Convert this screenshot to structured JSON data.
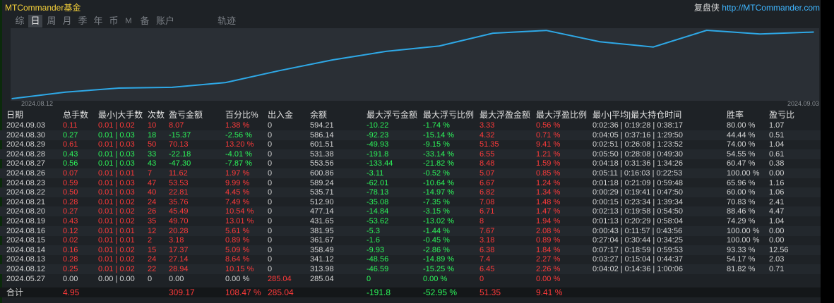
{
  "app_title": "MTCommander基金",
  "header_right": {
    "label": "复盘侠",
    "site": "http://MTCommander.com"
  },
  "tabs": [
    {
      "label": "综",
      "active": false,
      "small": false
    },
    {
      "label": "日",
      "active": true,
      "small": false
    },
    {
      "label": "周",
      "active": false,
      "small": false
    },
    {
      "label": "月",
      "active": false,
      "small": false
    },
    {
      "label": "季",
      "active": false,
      "small": false
    },
    {
      "label": "年",
      "active": false,
      "small": false
    },
    {
      "label": "币",
      "active": false,
      "small": false
    },
    {
      "label": "M",
      "active": false,
      "small": true
    },
    {
      "label": "备",
      "active": false,
      "small": false
    },
    {
      "label": "账户",
      "active": false,
      "small": false
    },
    {
      "label": "轨迹",
      "active": false,
      "small": false
    }
  ],
  "chart_data": {
    "type": "line",
    "x": [
      "2024.08.12",
      "2024.08.13",
      "2024.08.14",
      "2024.08.15",
      "2024.08.16",
      "2024.08.19",
      "2024.08.20",
      "2024.08.21",
      "2024.08.22",
      "2024.08.23",
      "2024.08.26",
      "2024.08.27",
      "2024.08.28",
      "2024.08.29",
      "2024.08.30",
      "2024.09.03"
    ],
    "values": [
      313.98,
      341.12,
      358.49,
      361.67,
      381.95,
      431.65,
      477.14,
      512.9,
      535.71,
      589.24,
      600.86,
      553.56,
      531.38,
      601.51,
      586.14,
      594.21
    ],
    "x_start_label": "2024.08.12",
    "x_end_label": "2024.09.03",
    "line_color": "#2ea8e6",
    "grid": false
  },
  "table": {
    "headers": [
      "日期",
      "总手数",
      "最小|大手数",
      "次数",
      "盈亏金额",
      "百分比%",
      "出入金",
      "余额",
      "最大浮亏金额",
      "最大浮亏比例",
      "最大浮盈金额",
      "最大浮盈比例",
      "最小|平均|最大持仓时间",
      "胜率",
      "盈亏比"
    ],
    "rows": [
      [
        "2024.09.03",
        "0.11",
        "0.01 | 0.02",
        "10",
        "8.07",
        "1.38 %",
        "0",
        "594.21",
        "-10.22",
        "-1.74 %",
        "3.33",
        "0.56 %",
        "0:02:36 | 0:19:28 | 0:38:17",
        "80.00 %",
        "1.07"
      ],
      [
        "2024.08.30",
        "0.27",
        "0.01 | 0.03",
        "18",
        "-15.37",
        "-2.56 %",
        "0",
        "586.14",
        "-92.23",
        "-15.14 %",
        "4.32",
        "0.71 %",
        "0:04:05 | 0:37:16 | 1:29:50",
        "44.44 %",
        "0.51"
      ],
      [
        "2024.08.29",
        "0.61",
        "0.01 | 0.03",
        "50",
        "70.13",
        "13.20 %",
        "0",
        "601.51",
        "-49.93",
        "-9.15 %",
        "51.35",
        "9.41 %",
        "0:02:51 | 0:26:08 | 1:23:52",
        "74.00 %",
        "1.04"
      ],
      [
        "2024.08.28",
        "0.43",
        "0.01 | 0.03",
        "33",
        "-22.18",
        "-4.01 %",
        "0",
        "531.38",
        "-191.8",
        "-33.14 %",
        "6.55",
        "1.21 %",
        "0:05:50 | 0:28:08 | 0:49:30",
        "54.55 %",
        "0.61"
      ],
      [
        "2024.08.27",
        "0.56",
        "0.01 | 0.03",
        "43",
        "-47.30",
        "-7.87 %",
        "0",
        "553.56",
        "-133.44",
        "-21.82 %",
        "8.48",
        "1.59 %",
        "0:04:18 | 0:31:36 | 1:34:26",
        "60.47 %",
        "0.38"
      ],
      [
        "2024.08.26",
        "0.07",
        "0.01 | 0.01",
        "7",
        "11.62",
        "1.97 %",
        "0",
        "600.86",
        "-3.11",
        "-0.52 %",
        "5.07",
        "0.85 %",
        "0:05:11 | 0:16:03 | 0:22:53",
        "100.00 %",
        "0.00"
      ],
      [
        "2024.08.23",
        "0.59",
        "0.01 | 0.03",
        "47",
        "53.53",
        "9.99 %",
        "0",
        "589.24",
        "-62.01",
        "-10.64 %",
        "6.67",
        "1.24 %",
        "0:01:18 | 0:21:09 | 0:59:48",
        "65.96 %",
        "1.16"
      ],
      [
        "2024.08.22",
        "0.50",
        "0.01 | 0.03",
        "40",
        "22.81",
        "4.45 %",
        "0",
        "535.71",
        "-78.13",
        "-14.97 %",
        "6.82",
        "1.34 %",
        "0:00:29 | 0:19:41 | 0:47:50",
        "60.00 %",
        "1.06"
      ],
      [
        "2024.08.21",
        "0.28",
        "0.01 | 0.02",
        "24",
        "35.76",
        "7.49 %",
        "0",
        "512.90",
        "-35.08",
        "-7.35 %",
        "7.08",
        "1.48 %",
        "0:00:15 | 0:23:34 | 1:39:34",
        "70.83 %",
        "2.41"
      ],
      [
        "2024.08.20",
        "0.27",
        "0.01 | 0.02",
        "26",
        "45.49",
        "10.54 %",
        "0",
        "477.14",
        "-14.84",
        "-3.15 %",
        "6.71",
        "1.47 %",
        "0:02:13 | 0:19:58 | 0:54:50",
        "88.46 %",
        "4.47"
      ],
      [
        "2024.08.19",
        "0.43",
        "0.01 | 0.02",
        "35",
        "49.70",
        "13.01 %",
        "0",
        "431.65",
        "-53.62",
        "-13.02 %",
        "8",
        "1.94 %",
        "0:01:13 | 0:20:29 | 0:58:04",
        "74.29 %",
        "1.04"
      ],
      [
        "2024.08.16",
        "0.12",
        "0.01 | 0.01",
        "12",
        "20.28",
        "5.61 %",
        "0",
        "381.95",
        "-5.3",
        "-1.44 %",
        "7.67",
        "2.08 %",
        "0:00:43 | 0:11:57 | 0:43:56",
        "100.00 %",
        "0.00"
      ],
      [
        "2024.08.15",
        "0.02",
        "0.01 | 0.01",
        "2",
        "3.18",
        "0.89 %",
        "0",
        "361.67",
        "-1.6",
        "-0.45 %",
        "3.18",
        "0.89 %",
        "0:27:04 | 0:30:44 | 0:34:25",
        "100.00 %",
        "0.00"
      ],
      [
        "2024.08.14",
        "0.16",
        "0.01 | 0.02",
        "15",
        "17.37",
        "5.09 %",
        "0",
        "358.49",
        "-9.93",
        "-2.86 %",
        "6.38",
        "1.84 %",
        "0:07:17 | 0:18:59 | 0:59:53",
        "93.33 %",
        "12.56"
      ],
      [
        "2024.08.13",
        "0.28",
        "0.01 | 0.02",
        "24",
        "27.14",
        "8.64 %",
        "0",
        "341.12",
        "-48.56",
        "-14.89 %",
        "7.4",
        "2.27 %",
        "0:03:27 | 0:15:04 | 0:44:37",
        "54.17 %",
        "2.03"
      ],
      [
        "2024.08.12",
        "0.25",
        "0.01 | 0.02",
        "22",
        "28.94",
        "10.15 %",
        "0",
        "313.98",
        "-46.59",
        "-15.25 %",
        "6.45",
        "2.26 %",
        "0:04:02 | 0:14:36 | 1:00:06",
        "81.82 %",
        "0.71"
      ],
      [
        "2024.05.27",
        "0.00",
        "0.00 | 0.00",
        "0",
        "0.00",
        "0.00 %",
        "285.04",
        "285.04",
        "0",
        "0.00 %",
        "0",
        "0.00 %",
        "",
        "",
        ""
      ]
    ],
    "total": [
      "合计",
      "4.95",
      "",
      "",
      "309.17",
      "108.47 %",
      "285.04",
      "",
      "-191.8",
      "-52.95 %",
      "51.35",
      "9.41 %",
      "",
      "",
      ""
    ]
  },
  "colors": {
    "profit": "#ff3a3a",
    "loss": "#2cf55a",
    "neutral": "#d4d4d4",
    "accent": "#f3cf3a",
    "link": "#3fb6ff"
  }
}
